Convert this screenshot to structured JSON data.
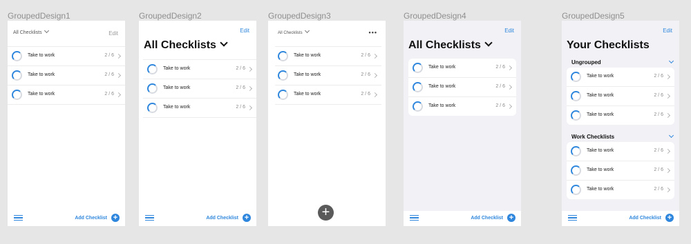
{
  "row": {
    "title": "Take to work",
    "count": "2 / 6"
  },
  "common": {
    "edit_label": "Edit",
    "add_label": "Add Checklist",
    "plus_glyph": "+"
  },
  "d1": {
    "label": "GroupedDesign1",
    "title": "All Checklists"
  },
  "d2": {
    "label": "GroupedDesign2",
    "title": "All Checklists"
  },
  "d3": {
    "label": "GroupedDesign3",
    "title": "All Checklists",
    "more": "•••",
    "fab": "+"
  },
  "d4": {
    "label": "GroupedDesign4",
    "title": "All Checklists"
  },
  "d5": {
    "label": "GroupedDesign5",
    "title": "Your Checklists",
    "section1": "Ungrouped",
    "section2": "Work Checklists"
  },
  "colors": {
    "accent": "#2f87dd",
    "canvas": "#e6e6e6",
    "grouped_bg": "#f1f1f6"
  }
}
